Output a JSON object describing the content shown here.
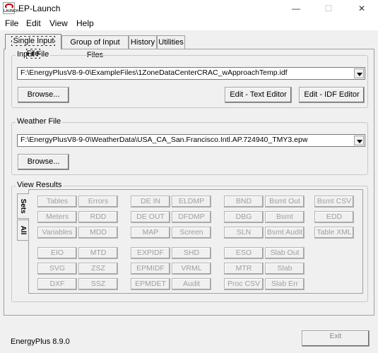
{
  "window": {
    "title": "EP-Launch",
    "icon_label": "LAUNCH",
    "minimize_glyph": "—",
    "maximize_glyph": "☐",
    "close_glyph": "✕"
  },
  "menu": [
    "File",
    "Edit",
    "View",
    "Help"
  ],
  "tabs": [
    "Single Input File",
    "Group of Input Files",
    "History",
    "Utilities"
  ],
  "input_file": {
    "label": "Input File",
    "value": "F:\\EnergyPlusV8-9-0\\ExampleFiles\\1ZoneDataCenterCRAC_wApproachTemp.idf",
    "browse": "Browse...",
    "edit_text": "Edit - Text Editor",
    "edit_idf": "Edit - IDF Editor"
  },
  "weather_file": {
    "label": "Weather File",
    "value": "F:\\EnergyPlusV8-9-0\\WeatherData\\USA_CA_San.Francisco.Intl.AP.724940_TMY3.epw",
    "browse": "Browse..."
  },
  "view_results": {
    "label": "View Results",
    "side_tabs": [
      "Sets",
      "All"
    ],
    "buttons": [
      "Tables",
      "Errors",
      "DE IN",
      "ELDMP",
      "BND",
      "Bsmt Out",
      "Bsmt CSV",
      "Meters",
      "RDD",
      "DE OUT",
      "DFDMP",
      "DBG",
      "Bsmt",
      "EDD",
      "Variables",
      "MDD",
      "MAP",
      "Screen",
      "SLN",
      "Bsmt Audit",
      "Table XML",
      "EIO",
      "MTD",
      "EXPIDF",
      "SHD",
      "ESO",
      "Slab Out",
      "SVG",
      "ZSZ",
      "EPMIDF",
      "VRML",
      "MTR",
      "Slab",
      "DXF",
      "SSZ",
      "EPMDET",
      "Audit",
      "Proc CSV",
      "Slab Err"
    ]
  },
  "status": {
    "text": "EnergyPlus 8.9.0",
    "exit_label": "Exit"
  }
}
